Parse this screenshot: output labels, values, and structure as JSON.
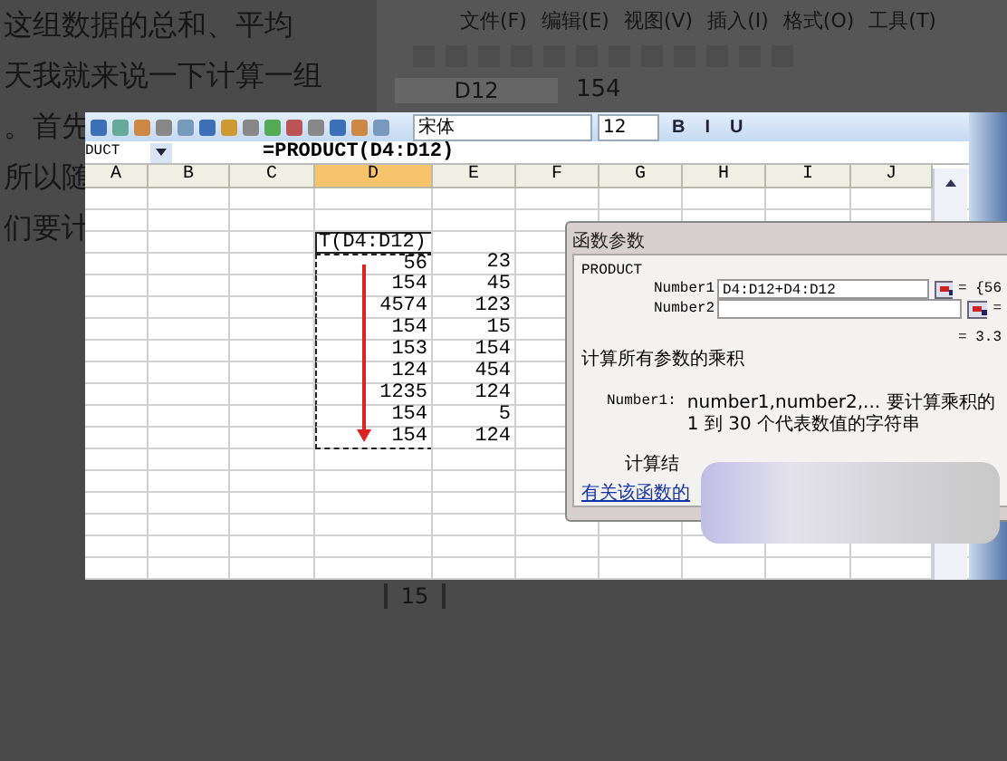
{
  "background_page": {
    "text_lines": [
      "这组数据的总和、平均",
      "天我就来说一下计算一组",
      "。首先",
      "所以随",
      "们要计"
    ],
    "excel": {
      "menu": [
        "文件(F)",
        "编辑(E)",
        "视图(V)",
        "插入(I)",
        "格式(O)",
        "工具(T)"
      ],
      "name_box": "D12",
      "formula": "154",
      "row_number": "15"
    }
  },
  "spreadsheet": {
    "toolbar": {
      "font": "宋体",
      "size": "12",
      "format_buttons": [
        "B",
        "I",
        "U"
      ]
    },
    "name_box": "DUCT",
    "formula": "=PRODUCT(D4:D12)",
    "columns": [
      {
        "label": "A",
        "selected": false
      },
      {
        "label": "B",
        "selected": false
      },
      {
        "label": "C",
        "selected": false
      },
      {
        "label": "D",
        "selected": true
      },
      {
        "label": "E",
        "selected": false
      },
      {
        "label": "F",
        "selected": false
      },
      {
        "label": "G",
        "selected": false
      },
      {
        "label": "H",
        "selected": false
      },
      {
        "label": "I",
        "selected": false
      },
      {
        "label": "J",
        "selected": false
      }
    ],
    "rows": [
      {},
      {},
      {
        "d": "T(D4:D12)",
        "active": true
      },
      {
        "d": "56",
        "e": "23",
        "in_range": true
      },
      {
        "d": "154",
        "e": "45",
        "in_range": true
      },
      {
        "d": "4574",
        "e": "123",
        "in_range": true
      },
      {
        "d": "154",
        "e": "15",
        "in_range": true
      },
      {
        "d": "153",
        "e": "154",
        "in_range": true
      },
      {
        "d": "124",
        "e": "454",
        "in_range": true
      },
      {
        "d": "1235",
        "e": "124",
        "in_range": true
      },
      {
        "d": "154",
        "e": "5",
        "in_range": true
      },
      {
        "d": "154",
        "e": "124",
        "in_range": true
      },
      {},
      {},
      {},
      {},
      {},
      {}
    ]
  },
  "dialog": {
    "title": "函数参数",
    "function": "PRODUCT",
    "args": [
      {
        "label": "Number1",
        "value": "D4:D12+D4:D12",
        "result": "= {56"
      },
      {
        "label": "Number2",
        "result": "="
      }
    ],
    "total": "= 3.3",
    "description": "计算所有参数的乘积",
    "arg_help": {
      "label": "Number1:",
      "text": "number1,number2,... 要计算乘积的 1 到 30 个代表数值的字符串"
    },
    "result_label": "计算结",
    "help_link": "有关该函数的"
  }
}
